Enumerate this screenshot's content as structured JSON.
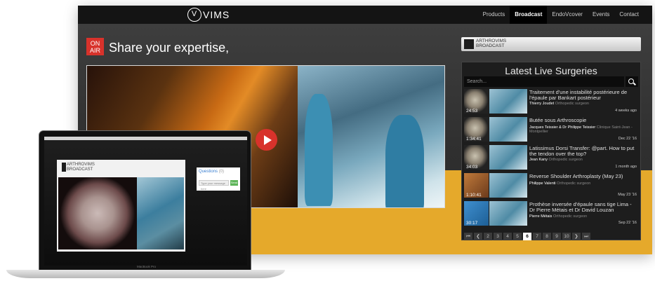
{
  "nav": {
    "logo": "VIMS",
    "items": [
      "Products",
      "Broadcast",
      "EndoVcover",
      "Events",
      "Contact"
    ],
    "active": "Broadcast"
  },
  "hero": {
    "on_air_top": "ON",
    "on_air_bottom": "AIR",
    "title": "Share your expertise,"
  },
  "sidebar": {
    "brand_line1": "ARTHROVIMS",
    "brand_line2": "BROADCAST",
    "latest_title": "Latest Live Surgeries",
    "search_placeholder": "Search..."
  },
  "surgeries": [
    {
      "title": "Traitement d'une instabilité postérieure de l'épaule par Bankart postérieur",
      "author": "Thierry Joudet",
      "role": "Orthopedic surgeon",
      "time": "4 weeks ago",
      "duration": "24:53"
    },
    {
      "title": "Butée sous Arthroscopie",
      "author": "Jacques Teissier & Dr Philippe Teissier",
      "role": "Clinique Saint-Jean - Montpellier",
      "time": "Dec 22 '16",
      "duration": "1:34:41"
    },
    {
      "title": "Latissimus Dorsi Transfer: @part. How to put the tendon over the top?",
      "author": "Jean Kany",
      "role": "Orthopedic surgeon",
      "time": "1 month ago",
      "duration": "34:03"
    },
    {
      "title": "Reverse Shoulder Arthroplasty (May 23)",
      "author": "Philippe Valenti",
      "role": "Orthopedic surgeon",
      "time": "May 23 '16",
      "duration": "1:10:41"
    },
    {
      "title": "Prothèse inversée d'épaule sans tige Lima - Dr Pierre Métais et Dr David Louzan",
      "author": "Pierre Métais",
      "role": "Orthopedic surgeon",
      "time": "Sep 22 '16",
      "duration": "30:17"
    }
  ],
  "pager": [
    "⏮",
    "❮",
    "2",
    "3",
    "4",
    "5",
    "6",
    "7",
    "8",
    "9",
    "10",
    "❯",
    "⏭"
  ],
  "pager_active": "6",
  "laptop": {
    "brand_line1": "ARTHROVIMS",
    "brand_line2": "BROADCAST",
    "questions_title": "Questions",
    "questions_count": "(0)",
    "input_placeholder": "Type your message here",
    "send_label": "Send",
    "model_label": "MacBook Pro"
  },
  "colors": {
    "accent_red": "#d8322b",
    "accent_yellow": "#e5a92b"
  }
}
